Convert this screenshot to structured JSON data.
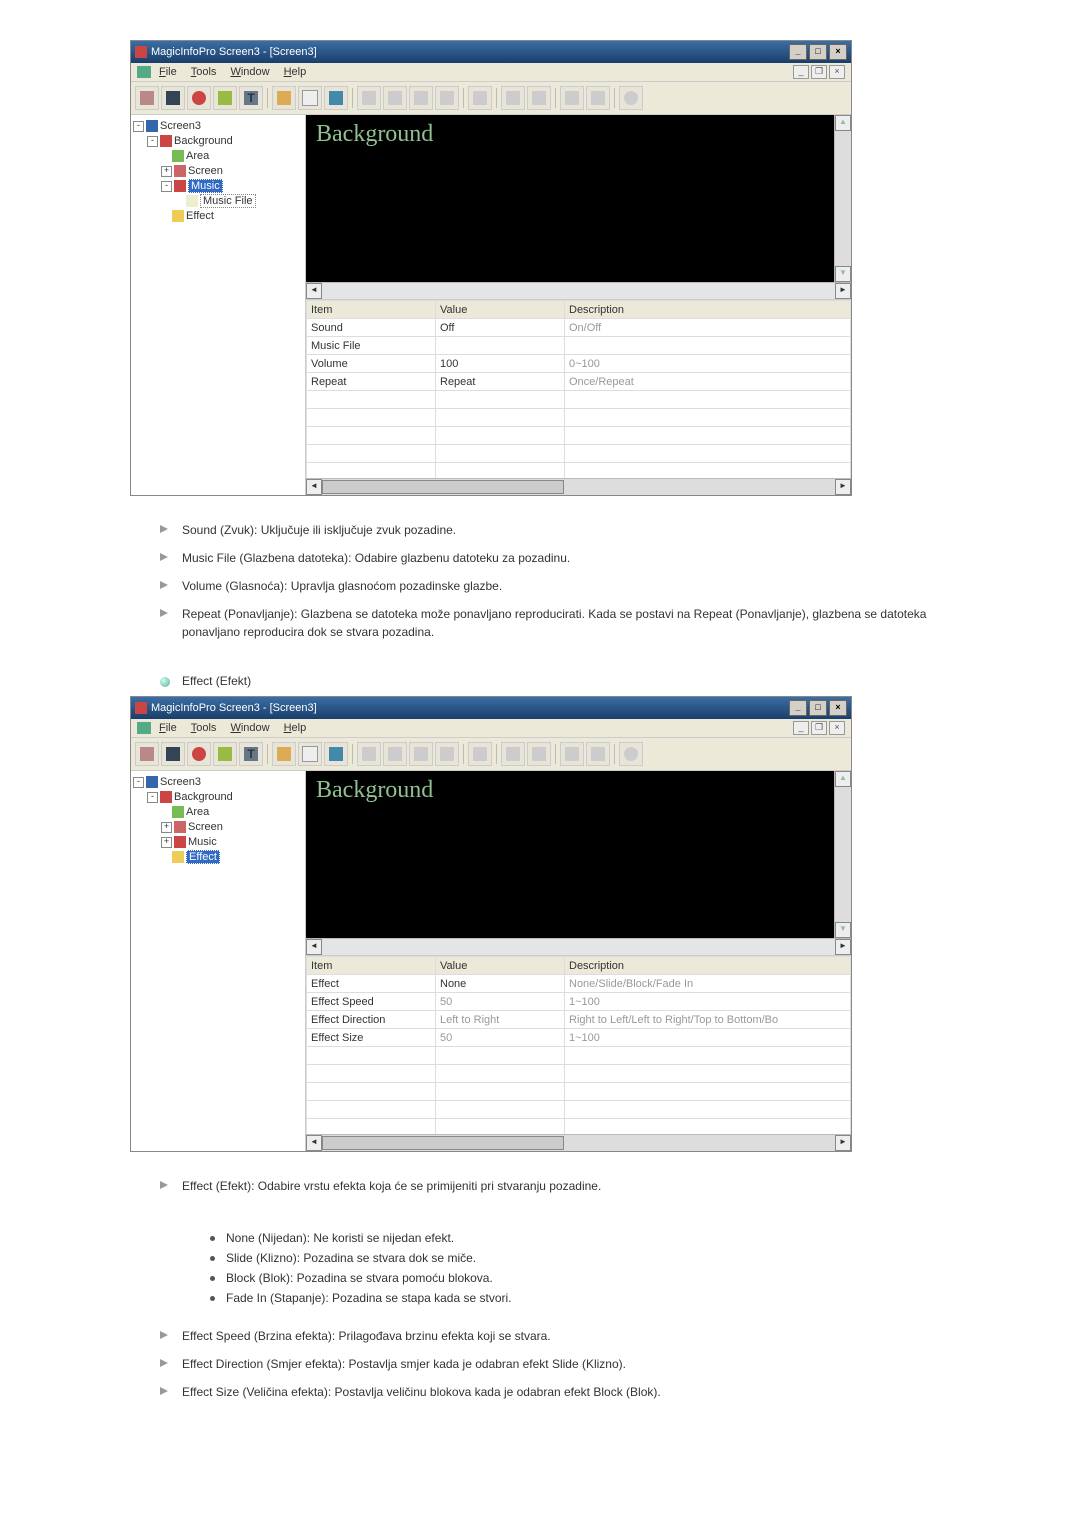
{
  "window": {
    "title": "MagicInfoPro Screen3 - [Screen3]",
    "menu": {
      "file": "File",
      "tools": "Tools",
      "window": "Window",
      "help": "Help"
    }
  },
  "tree_music": {
    "root": "Screen3",
    "background": "Background",
    "area": "Area",
    "screen": "Screen",
    "music": "Music",
    "music_file": "Music File",
    "effect": "Effect"
  },
  "tree_effect": {
    "root": "Screen3",
    "background": "Background",
    "area": "Area",
    "screen": "Screen",
    "music": "Music",
    "effect": "Effect"
  },
  "preview_label": "Background",
  "grid_headers": {
    "item": "Item",
    "value": "Value",
    "desc": "Description"
  },
  "grid_music": [
    {
      "item": "Sound",
      "value": "Off",
      "desc": "On/Off"
    },
    {
      "item": "Music File",
      "value": "",
      "desc": ""
    },
    {
      "item": "Volume",
      "value": "100",
      "desc": "0~100"
    },
    {
      "item": "Repeat",
      "value": "Repeat",
      "desc": "Once/Repeat"
    }
  ],
  "grid_effect": [
    {
      "item": "Effect",
      "value": "None",
      "desc": "None/Slide/Block/Fade In"
    },
    {
      "item": "Effect Speed",
      "value": "50",
      "desc": "1~100",
      "dim": true
    },
    {
      "item": "Effect Direction",
      "value": "Left to Right",
      "desc": "Right to Left/Left to Right/Top to Bottom/Bo",
      "dim": true
    },
    {
      "item": "Effect Size",
      "value": "50",
      "desc": "1~100",
      "dim": true
    }
  ],
  "doc": {
    "list1": [
      "Sound (Zvuk): Uključuje ili isključuje zvuk pozadine.",
      "Music File (Glazbena datoteka): Odabire glazbenu datoteku za pozadinu.",
      "Volume (Glasnoća): Upravlja glasnoćom pozadinske glazbe.",
      "Repeat (Ponavljanje): Glazbena se datoteka može ponavljano reproducirati. Kada se postavi na Repeat (Ponavljanje), glazbena se datoteka ponavljano reproducira dok se stvara pozadina."
    ],
    "heading": "Effect (Efekt)",
    "list2_first": "Effect (Efekt): Odabire vrstu efekta koja će se primijeniti pri stvaranju pozadine.",
    "sub_bullets": [
      "None (Nijedan): Ne koristi se nijedan efekt.",
      "Slide (Klizno): Pozadina se stvara dok se miče.",
      "Block (Blok): Pozadina se stvara pomoću blokova.",
      "Fade In (Stapanje): Pozadina se stapa kada se stvori."
    ],
    "list2_rest": [
      "Effect Speed (Brzina efekta): Prilagođava brzinu efekta koji se stvara.",
      "Effect Direction (Smjer efekta): Postavlja smjer kada je odabran efekt Slide (Klizno).",
      "Effect Size (Veličina efekta): Postavlja veličinu blokova kada je odabran efekt Block (Blok)."
    ]
  }
}
